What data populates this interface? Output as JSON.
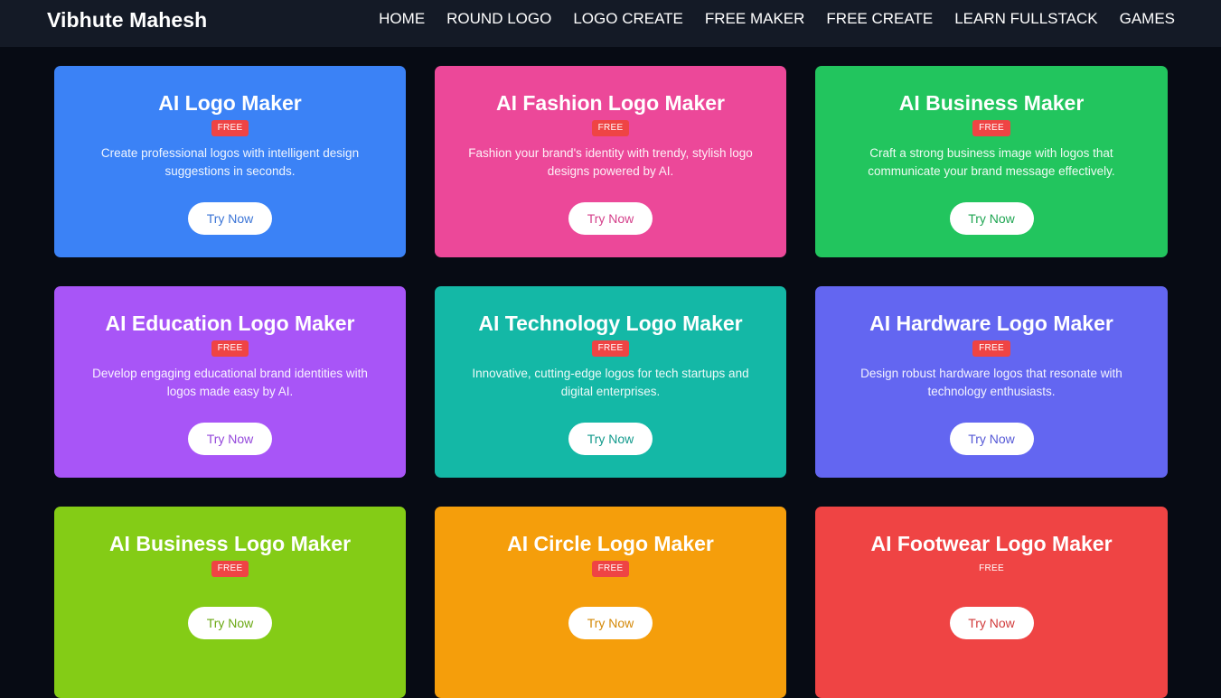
{
  "brand": "Vibhute Mahesh",
  "nav": [
    {
      "label": "HOME",
      "name": "nav-home"
    },
    {
      "label": "ROUND LOGO",
      "name": "nav-round-logo"
    },
    {
      "label": "LOGO CREATE",
      "name": "nav-logo-create"
    },
    {
      "label": "FREE MAKER",
      "name": "nav-free-maker"
    },
    {
      "label": "FREE CREATE",
      "name": "nav-free-create"
    },
    {
      "label": "LEARN FULLSTACK",
      "name": "nav-learn-fullstack"
    },
    {
      "label": "GAMES",
      "name": "nav-games"
    }
  ],
  "cards": [
    {
      "title": "AI Logo Maker",
      "badge": "FREE",
      "desc": "Create professional logos with intelligent design suggestions in seconds.",
      "button": "Try Now",
      "bg": "#3b82f6",
      "btn_color": "#3b74d6"
    },
    {
      "title": "AI Fashion Logo Maker",
      "badge": "FREE",
      "desc": "Fashion your brand's identity with trendy, stylish logo designs powered by AI.",
      "button": "Try Now",
      "bg": "#ec4899",
      "btn_color": "#d43f8a"
    },
    {
      "title": "AI Business Maker",
      "badge": "FREE",
      "desc": "Craft a strong business image with logos that communicate your brand message effectively.",
      "button": "Try Now",
      "bg": "#22c55e",
      "btn_color": "#1fa552"
    },
    {
      "title": "AI Education Logo Maker",
      "badge": "FREE",
      "desc": "Develop engaging educational brand identities with logos made easy by AI.",
      "button": "Try Now",
      "bg": "#a855f7",
      "btn_color": "#9447db"
    },
    {
      "title": "AI Technology Logo Maker",
      "badge": "FREE",
      "desc": "Innovative, cutting-edge logos for tech startups and digital enterprises.",
      "button": "Try Now",
      "bg": "#14b8a6",
      "btn_color": "#129a8c"
    },
    {
      "title": "AI Hardware Logo Maker",
      "badge": "FREE",
      "desc": "Design robust hardware logos that resonate with technology enthusiasts.",
      "button": "Try Now",
      "bg": "#6366f1",
      "btn_color": "#5558d6"
    },
    {
      "title": "AI Business Logo Maker",
      "badge": "FREE",
      "desc": "",
      "button": "Try Now",
      "bg": "#84cc16",
      "btn_color": "#6aa812"
    },
    {
      "title": "AI Circle Logo Maker",
      "badge": "FREE",
      "desc": "",
      "button": "Try Now",
      "bg": "#f59e0b",
      "btn_color": "#d48806"
    },
    {
      "title": "AI Footwear Logo Maker",
      "badge": "FREE",
      "desc": "",
      "button": "Try Now",
      "bg": "#ef4444",
      "btn_color": "#d13a3a"
    }
  ]
}
